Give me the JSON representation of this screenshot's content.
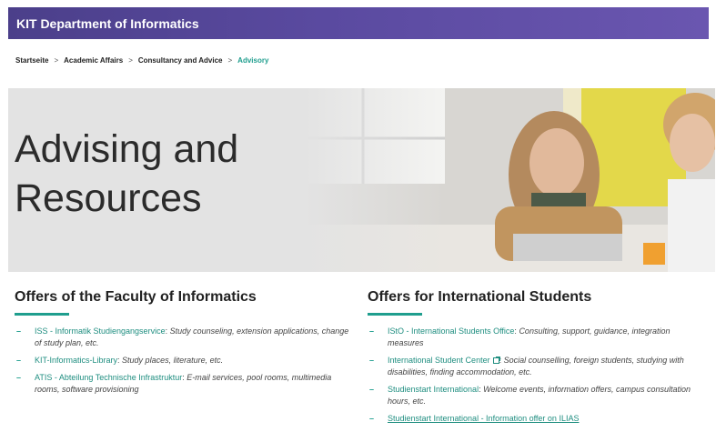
{
  "header": {
    "title": "KIT Department of Informatics"
  },
  "breadcrumb": {
    "items": [
      "Startseite",
      "Academic Affairs",
      "Consultancy and Advice"
    ],
    "separator": ">",
    "current": "Advisory"
  },
  "hero": {
    "title_line1": "Advising and",
    "title_line2": "Resources"
  },
  "left": {
    "heading": "Offers of the Faculty of Informatics",
    "items": [
      {
        "link": "ISS - Informatik Studiengangservice",
        "desc": "Study counseling, extension applications, change of study plan, etc."
      },
      {
        "link": "KIT-Informatics-Library",
        "desc": "Study places, literature, etc."
      },
      {
        "link": "ATIS - Abteilung Technische Infrastruktur",
        "desc": "E-mail services, pool rooms, multimedia rooms, software provisioning"
      }
    ]
  },
  "right": {
    "heading": "Offers for International Students",
    "items": [
      {
        "link": "IStO - International Students Office",
        "desc": "Consulting, support, guidance, integration measures"
      },
      {
        "link": "International Student Center",
        "desc": "Social counselling, foreign students, studying with disabilities, finding accommodation, etc."
      },
      {
        "link": "Studienstart International",
        "desc": "Welcome events, information offers, campus consultation hours, etc."
      },
      {
        "link": "Studienstart International - Information offer on ILIAS",
        "desc": ""
      }
    ]
  },
  "colors": {
    "accent": "#1f9e8e",
    "header_bg": "#5a4aa0"
  },
  "icons": {
    "external_link": "external-link-icon"
  }
}
